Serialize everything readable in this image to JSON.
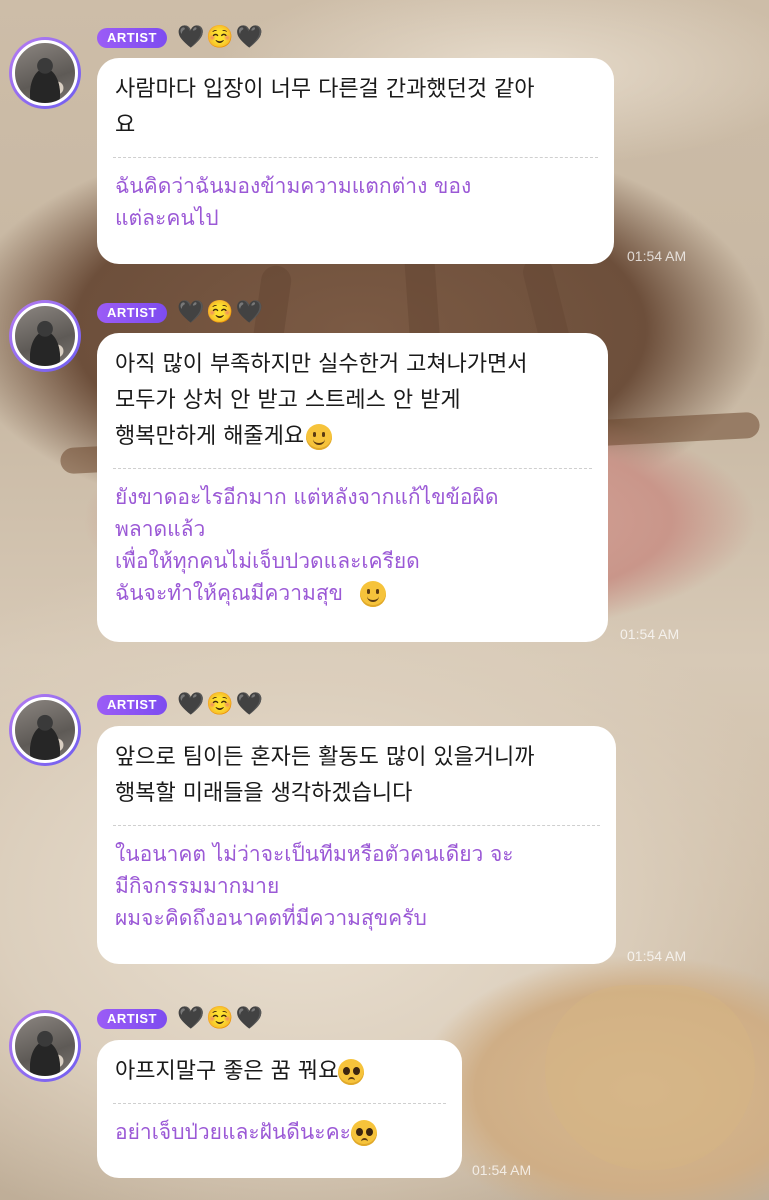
{
  "messages": [
    {
      "badge": "ARTIST",
      "emojis": "🖤☺️🖤",
      "korean": "사람마다 입장이 너무 다른걸 간과했던것 같아\n요",
      "thai": "ฉันคิดว่าฉันมองข้ามความแตกต่าง ของ\nแต่ละคนไป",
      "time": "01:54 AM"
    },
    {
      "badge": "ARTIST",
      "emojis": "🖤☺️🖤",
      "korean": "아직 많이 부족하지만 실수한거 고쳐나가면서\n모두가 상처 안 받고 스트레스 안 받게\n행복만하게 해줄게요",
      "thai": "ยังขาดอะไรอีกมาก แต่หลังจากแก้ไขข้อผิด\nพลาดแล้ว\nเพื่อให้ทุกคนไม่เจ็บปวดและเครียด\nฉันจะทำให้คุณมีความสุข ",
      "time": "01:54 AM"
    },
    {
      "badge": "ARTIST",
      "emojis": "🖤☺️🖤",
      "korean": "앞으로 팀이든 혼자든 활동도 많이 있을거니까\n행복할 미래들을 생각하겠습니다",
      "thai": "ในอนาคต ไม่ว่าจะเป็นทีมหรือตัวคนเดียว จะ\nมีกิจกรรมมากมาย\nผมจะคิดถึงอนาคตที่มีความสุขครับ",
      "time": "01:54 AM"
    },
    {
      "badge": "ARTIST",
      "emojis": "🖤☺️🖤",
      "korean": "아프지말구 좋은 꿈 꿔요",
      "thai": "อย่าเจ็บป่วยและฝันดีนะคะ",
      "time": "01:54 AM"
    }
  ],
  "icons": {
    "smile": "slightly-smiling-face-icon",
    "plead": "pleading-face-icon"
  }
}
